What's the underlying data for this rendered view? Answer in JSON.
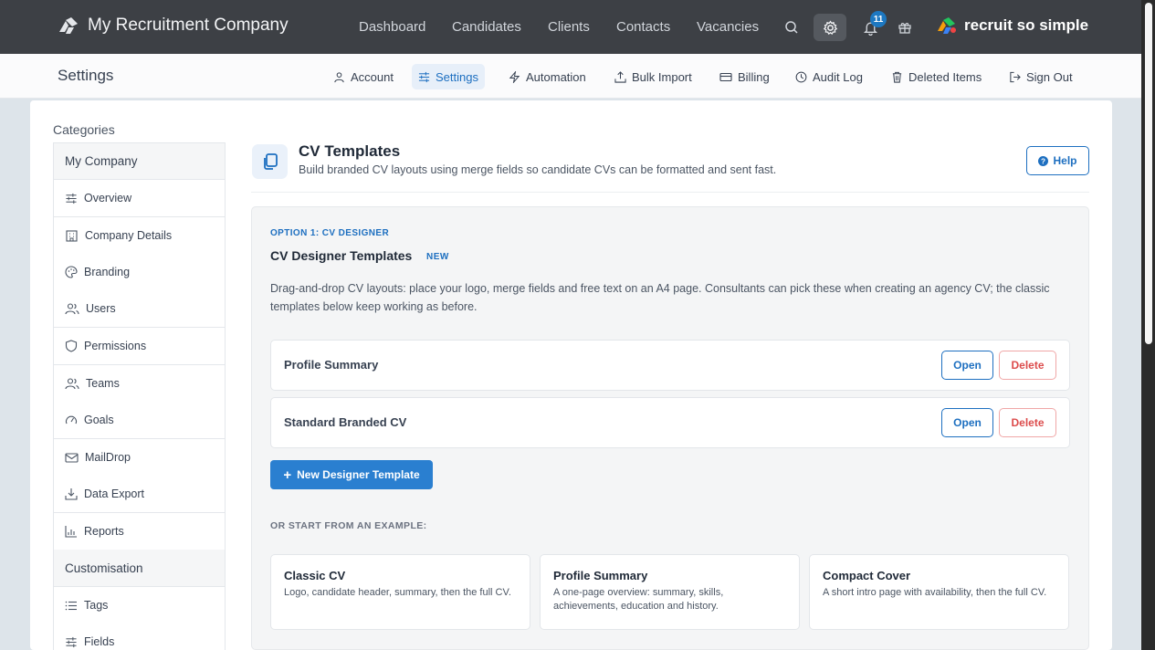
{
  "topbar": {
    "company_name": "My Recruitment Company",
    "nav": [
      "Dashboard",
      "Candidates",
      "Clients",
      "Contacts",
      "Vacancies"
    ],
    "notification_count": "11",
    "product_logo": "recruit so simple"
  },
  "subbar": {
    "title": "Settings",
    "links": [
      "Account",
      "Settings",
      "Automation",
      "Bulk Import",
      "Billing",
      "Audit Log",
      "Deleted Items",
      "Sign Out"
    ],
    "active_link": "Settings"
  },
  "sidebar": {
    "heading": "Categories",
    "group1": "My Company",
    "items1": [
      "Overview",
      "Company Details",
      "Branding",
      "Users",
      "Permissions",
      "Teams",
      "Goals",
      "MailDrop",
      "Data Export",
      "Reports"
    ],
    "group2": "Customisation",
    "items2": [
      "Tags",
      "Fields"
    ]
  },
  "page": {
    "title": "CV Templates",
    "subtitle": "Build branded CV layouts using merge fields so candidate CVs can be formatted and sent fast.",
    "help_label": "Help"
  },
  "option1": {
    "label": "OPTION 1: CV DESIGNER",
    "title": "CV Designer Templates",
    "new_tag": "NEW",
    "description": "Drag-and-drop CV layouts: place your logo, merge fields and free text on an A4 page. Consultants can pick these when creating an agency CV; the classic templates below keep working as before.",
    "templates": [
      {
        "name": "Profile Summary",
        "open": "Open",
        "delete": "Delete"
      },
      {
        "name": "Standard Branded CV",
        "open": "Open",
        "delete": "Delete"
      }
    ],
    "new_button": "New Designer Template",
    "examples_label": "OR START FROM AN EXAMPLE:",
    "examples": [
      {
        "title": "Classic CV",
        "desc": "Logo, candidate header, summary, then the full CV."
      },
      {
        "title": "Profile Summary",
        "desc": "A one-page overview: summary, skills, achievements, education and history."
      },
      {
        "title": "Compact Cover",
        "desc": "A short intro page with availability, then the full CV."
      }
    ]
  },
  "colors": {
    "topbar_bg": "#3d4045",
    "accent": "#1d6fc0",
    "danger": "#dc4c4c",
    "badge": "#1d78c1"
  }
}
